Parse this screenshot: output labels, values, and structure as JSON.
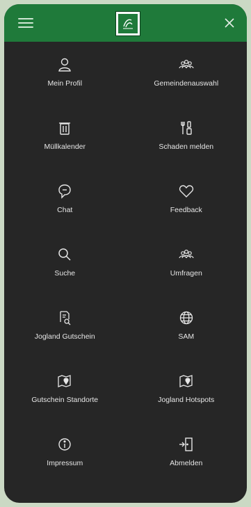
{
  "header": {
    "menu_icon": "hamburger-icon",
    "logo": "municipality-logo",
    "close_icon": "close-icon"
  },
  "menu": {
    "items": [
      {
        "label": "Mein Profil",
        "icon": "person-icon"
      },
      {
        "label": "Gemeindenauswahl",
        "icon": "community-icon"
      },
      {
        "label": "Müllkalender",
        "icon": "trash-bin-icon"
      },
      {
        "label": "Schaden melden",
        "icon": "tools-icon"
      },
      {
        "label": "Chat",
        "icon": "chat-icon"
      },
      {
        "label": "Feedback",
        "icon": "heart-icon"
      },
      {
        "label": "Suche",
        "icon": "search-icon"
      },
      {
        "label": "Umfragen",
        "icon": "survey-people-icon"
      },
      {
        "label": "Jogland Gutschein",
        "icon": "voucher-icon"
      },
      {
        "label": "SAM",
        "icon": "globe-icon"
      },
      {
        "label": "Gutschein Standorte",
        "icon": "map-pin-icon"
      },
      {
        "label": "Jogland Hotspots",
        "icon": "hotspot-map-icon"
      },
      {
        "label": "Impressum",
        "icon": "info-icon"
      },
      {
        "label": "Abmelden",
        "icon": "logout-icon"
      }
    ]
  },
  "colors": {
    "header_green": "#1f7a3a",
    "panel": "#262626",
    "background": "#cbd9c4",
    "text": "#e6e6e6"
  }
}
